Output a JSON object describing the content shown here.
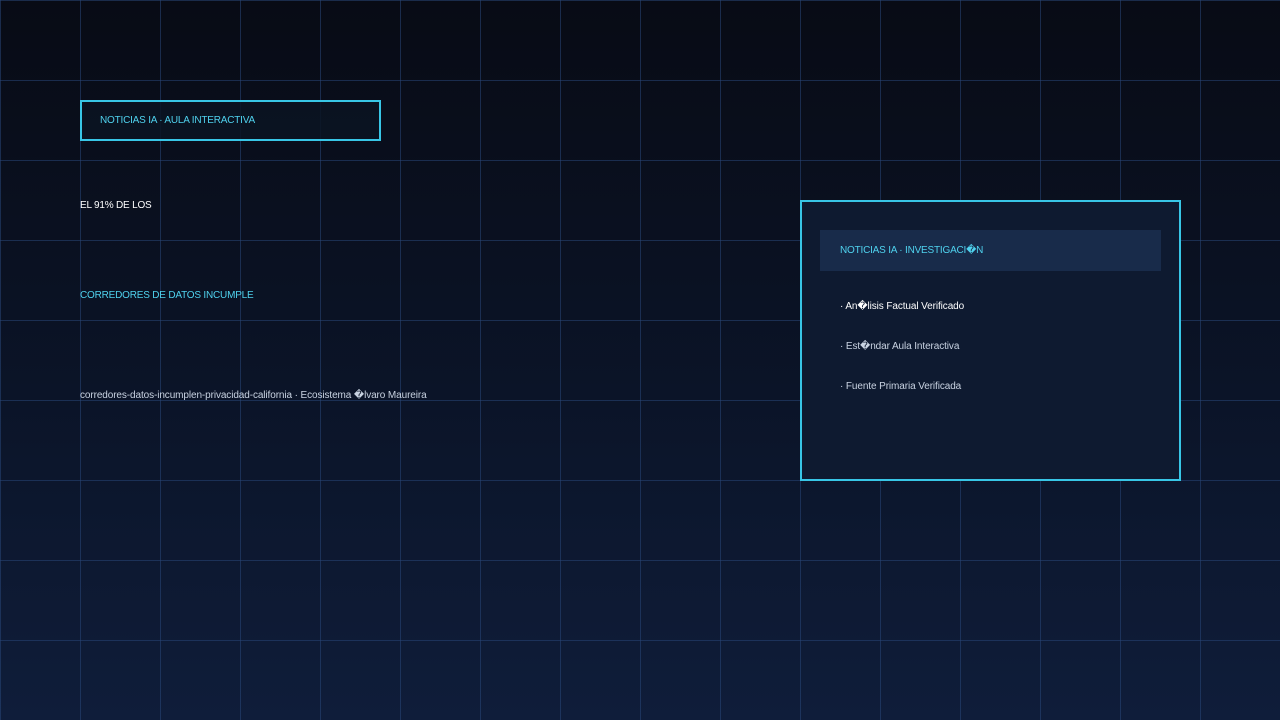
{
  "header": {
    "tag_label": "NOTICIAS IA · AULA INTERACTIVA"
  },
  "article": {
    "headline_line1": "EL 91% DE LOS",
    "headline_line2": "CORREDORES DE DATOS INCUMPLE",
    "slug_line": "corredores-datos-incumplen-privacidad-california · Ecosistema �lvaro Maureira"
  },
  "panel": {
    "title": "NOTICIAS IA · INVESTIGACI�N",
    "items": [
      "· An�lisis Factual Verificado",
      "· Est�ndar Aula Interactiva",
      "· Fuente Primaria Verificada"
    ]
  },
  "colors": {
    "accent": "#38c6e6",
    "accent_text": "#4fd2ee",
    "background_top": "#080b15",
    "background_bottom": "#0f1d3a",
    "panel_bg": "#0e1a30",
    "panel_header_bg": "#182b4a"
  }
}
